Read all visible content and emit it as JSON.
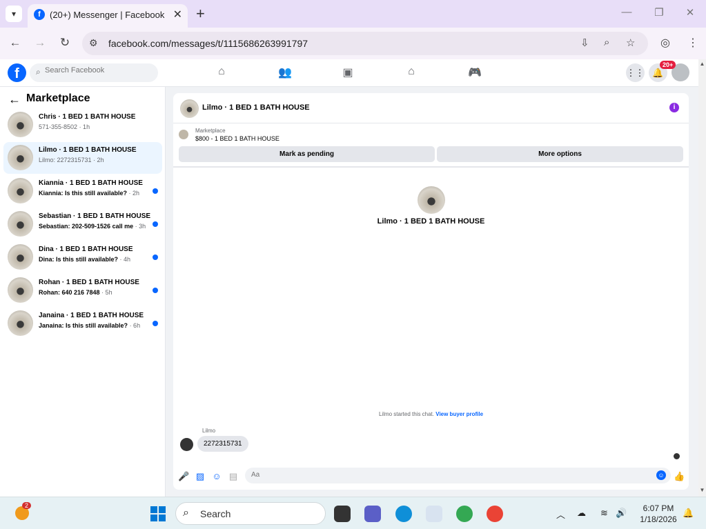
{
  "browser": {
    "tab_title": "(20+) Messenger | Facebook",
    "url": "facebook.com/messages/t/1115686263991797"
  },
  "fb_header": {
    "search_placeholder": "Search Facebook",
    "notification_badge": "20+"
  },
  "sidebar": {
    "title": "Marketplace",
    "conversations": [
      {
        "name": "Chris · 1 BED 1 BATH HOUSE",
        "snippet": "571-355-8502",
        "time": " · 1h",
        "unread": false,
        "active": false
      },
      {
        "name": "Lilmo · 1 BED 1 BATH HOUSE",
        "snippet": "Lilmo: 2272315731",
        "time": " · 2h",
        "unread": false,
        "active": true
      },
      {
        "name": "Kiannia · 1 BED 1 BATH HOUSE",
        "snippet": "Kiannia: Is this still available?",
        "time": " · 2h",
        "unread": true,
        "active": false
      },
      {
        "name": "Sebastian · 1 BED 1 BATH HOUSE",
        "snippet": "Sebastian: 202-509-1526 call me",
        "time": " · 3h",
        "unread": true,
        "active": false
      },
      {
        "name": "Dina · 1 BED 1 BATH HOUSE",
        "snippet": "Dina: Is this still available?",
        "time": " · 4h",
        "unread": true,
        "active": false
      },
      {
        "name": "Rohan · 1 BED 1 BATH HOUSE",
        "snippet": "Rohan: 640 216 7848",
        "time": " · 5h",
        "unread": true,
        "active": false
      },
      {
        "name": "Janaina · 1 BED 1 BATH HOUSE",
        "snippet": "Janaina: Is this still available?",
        "time": " · 6h",
        "unread": true,
        "active": false
      }
    ]
  },
  "chat": {
    "title": "Lilmo · 1 BED 1 BATH HOUSE",
    "marketplace_label": "Marketplace",
    "listing": "$800 - 1 BED 1 BATH HOUSE",
    "mark_pending_label": "Mark as pending",
    "more_options_label": "More options",
    "center_name": "Lilmo · 1 BED 1 BATH HOUSE",
    "started_text": "Lilmo started this chat.",
    "buyer_profile_link": "View buyer profile",
    "sender_label": "Lilmo",
    "message": "2272315731",
    "composer_placeholder": "Aa"
  },
  "taskbar": {
    "weather_badge": "2",
    "search_label": "Search",
    "time": "6:07 PM",
    "date": "1/18/2026"
  },
  "colors": {
    "fb_blue": "#0866ff",
    "active_conv_bg": "#ebf5ff",
    "chrome_tabbar": "#e8def8",
    "taskbar_bg": "#e6f1f4"
  }
}
